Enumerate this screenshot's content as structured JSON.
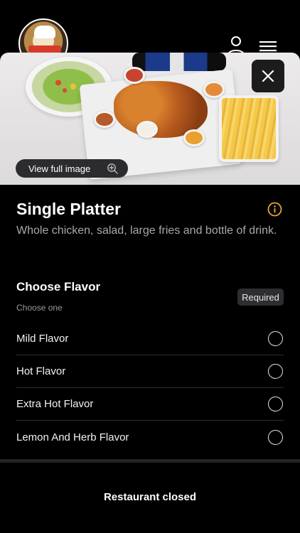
{
  "header": {
    "logo_icon": "restaurant-logo",
    "user_icon": "user-icon",
    "menu_icon": "hamburger-menu-icon"
  },
  "hero": {
    "view_full_image_label": "View full image",
    "close_icon": "close-icon",
    "zoom_icon": "zoom-in-icon"
  },
  "item": {
    "title": "Single Platter",
    "description": "Whole chicken, salad, large fries and bottle of drink.",
    "info_icon": "info-icon",
    "info_color": "#E8A23A"
  },
  "flavor_section": {
    "title": "Choose Flavor",
    "subtitle": "Choose one",
    "badge": "Required",
    "options": [
      {
        "label": "Mild Flavor",
        "selected": false
      },
      {
        "label": "Hot Flavor",
        "selected": false
      },
      {
        "label": "Extra Hot Flavor",
        "selected": false
      },
      {
        "label": "Lemon And Herb Flavor",
        "selected": false
      }
    ]
  },
  "footer": {
    "status_text": "Restaurant closed"
  }
}
